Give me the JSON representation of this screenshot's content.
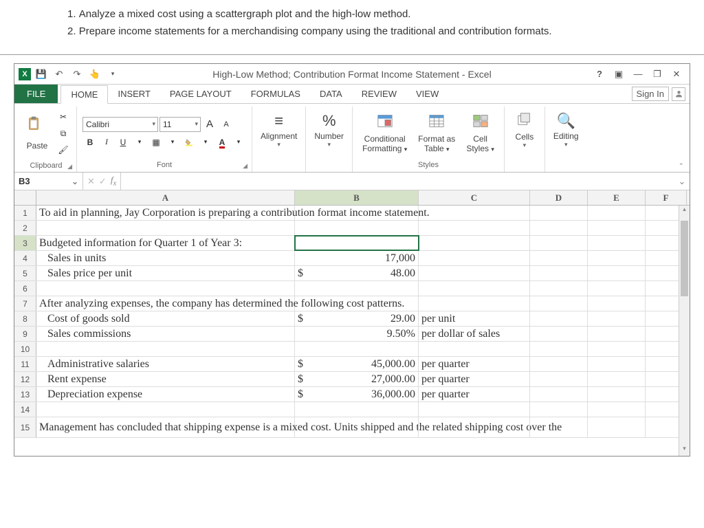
{
  "instructions": {
    "item1": "Analyze a mixed cost using a scattergraph plot and the high-low method.",
    "item2": "Prepare income statements for a merchandising company using the traditional and contribution formats."
  },
  "qat": {
    "title": "High-Low Method; Contribution Format Income Statement - Excel"
  },
  "tabs": {
    "file": "FILE",
    "home": "HOME",
    "insert": "INSERT",
    "pagelayout": "PAGE LAYOUT",
    "formulas": "FORMULAS",
    "data": "DATA",
    "review": "REVIEW",
    "view": "VIEW",
    "signin": "Sign In"
  },
  "ribbon": {
    "paste": "Paste",
    "clipboard": "Clipboard",
    "font_name": "Calibri",
    "font_size": "11",
    "font": "Font",
    "alignment": "Alignment",
    "number": "Number",
    "cond": "Conditional Formatting",
    "cond_line1": "Conditional",
    "cond_line2": "Formatting",
    "fmt_table_line1": "Format as",
    "fmt_table_line2": "Table",
    "cellstyles_line1": "Cell",
    "cellstyles_line2": "Styles",
    "styles": "Styles",
    "cells": "Cells",
    "editing": "Editing",
    "pct": "%",
    "bold": "B",
    "italic": "I",
    "underline": "U",
    "bigA": "A",
    "smallA": "A"
  },
  "namebox": "B3",
  "columns": {
    "A": "A",
    "B": "B",
    "C": "C",
    "D": "D",
    "E": "E",
    "F": "F"
  },
  "rows": {
    "r1_A": "To aid in planning, Jay Corporation is preparing a contribution format income statement.",
    "r3_A": "Budgeted information for Quarter 1 of Year 3:",
    "r4_A": "Sales in units",
    "r4_B": "17,000",
    "r5_A": "Sales price per unit",
    "r5_Bcur": "$",
    "r5_B": "48.00",
    "r7_A": "After analyzing expenses, the company has determined the following cost patterns.",
    "r8_A": "Cost of goods sold",
    "r8_Bcur": "$",
    "r8_B": "29.00",
    "r8_C": "per unit",
    "r9_A": "Sales commissions",
    "r9_B": "9.50%",
    "r9_C": "per dollar of sales",
    "r11_A": "Administrative salaries",
    "r11_Bcur": "$",
    "r11_B": "45,000.00",
    "r11_C": "per quarter",
    "r12_A": "Rent expense",
    "r12_Bcur": "$",
    "r12_B": "27,000.00",
    "r12_C": "per quarter",
    "r13_A": "Depreciation expense",
    "r13_Bcur": "$",
    "r13_B": "36,000.00",
    "r13_C": "per quarter",
    "r15_A": "Management has concluded that shipping expense is a mixed cost. Units shipped and the related shipping cost over the"
  }
}
